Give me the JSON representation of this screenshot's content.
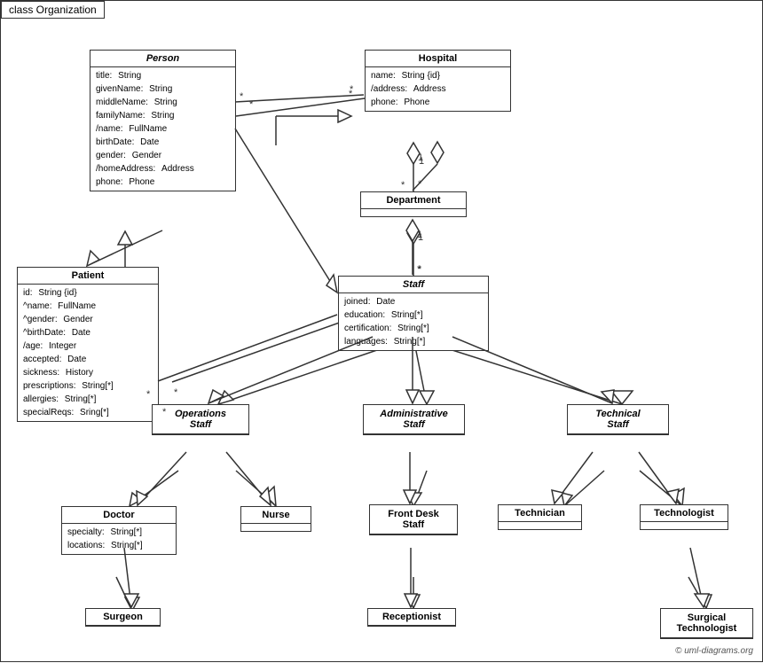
{
  "diagram": {
    "title": "class Organization",
    "classes": {
      "person": {
        "name": "Person",
        "italic": true,
        "attrs": [
          {
            "name": "title:",
            "type": "String"
          },
          {
            "name": "givenName:",
            "type": "String"
          },
          {
            "name": "middleName:",
            "type": "String"
          },
          {
            "name": "familyName:",
            "type": "String"
          },
          {
            "name": "/name:",
            "type": "FullName"
          },
          {
            "name": "birthDate:",
            "type": "Date"
          },
          {
            "name": "gender:",
            "type": "Gender"
          },
          {
            "name": "/homeAddress:",
            "type": "Address"
          },
          {
            "name": "phone:",
            "type": "Phone"
          }
        ]
      },
      "hospital": {
        "name": "Hospital",
        "italic": false,
        "attrs": [
          {
            "name": "name:",
            "type": "String {id}"
          },
          {
            "name": "/address:",
            "type": "Address"
          },
          {
            "name": "phone:",
            "type": "Phone"
          }
        ]
      },
      "department": {
        "name": "Department",
        "italic": false,
        "attrs": []
      },
      "staff": {
        "name": "Staff",
        "italic": true,
        "attrs": [
          {
            "name": "joined:",
            "type": "Date"
          },
          {
            "name": "education:",
            "type": "String[*]"
          },
          {
            "name": "certification:",
            "type": "String[*]"
          },
          {
            "name": "languages:",
            "type": "String[*]"
          }
        ]
      },
      "patient": {
        "name": "Patient",
        "italic": false,
        "attrs": [
          {
            "name": "id:",
            "type": "String {id}"
          },
          {
            "name": "^name:",
            "type": "FullName"
          },
          {
            "name": "^gender:",
            "type": "Gender"
          },
          {
            "name": "^birthDate:",
            "type": "Date"
          },
          {
            "name": "/age:",
            "type": "Integer"
          },
          {
            "name": "accepted:",
            "type": "Date"
          },
          {
            "name": "sickness:",
            "type": "History"
          },
          {
            "name": "prescriptions:",
            "type": "String[*]"
          },
          {
            "name": "allergies:",
            "type": "String[*]"
          },
          {
            "name": "specialReqs:",
            "type": "Sring[*]"
          }
        ]
      },
      "operations_staff": {
        "name": "Operations Staff",
        "italic": true
      },
      "administrative_staff": {
        "name": "Administrative Staff",
        "italic": true
      },
      "technical_staff": {
        "name": "Technical Staff",
        "italic": true
      },
      "doctor": {
        "name": "Doctor",
        "italic": false,
        "attrs": [
          {
            "name": "specialty:",
            "type": "String[*]"
          },
          {
            "name": "locations:",
            "type": "String[*]"
          }
        ]
      },
      "nurse": {
        "name": "Nurse",
        "italic": false,
        "attrs": []
      },
      "front_desk_staff": {
        "name": "Front Desk Staff",
        "italic": false,
        "attrs": []
      },
      "technician": {
        "name": "Technician",
        "italic": false,
        "attrs": []
      },
      "technologist": {
        "name": "Technologist",
        "italic": false,
        "attrs": []
      },
      "surgeon": {
        "name": "Surgeon",
        "italic": false,
        "attrs": []
      },
      "receptionist": {
        "name": "Receptionist",
        "italic": false,
        "attrs": []
      },
      "surgical_technologist": {
        "name": "Surgical Technologist",
        "italic": false,
        "attrs": []
      }
    },
    "copyright": "© uml-diagrams.org"
  }
}
